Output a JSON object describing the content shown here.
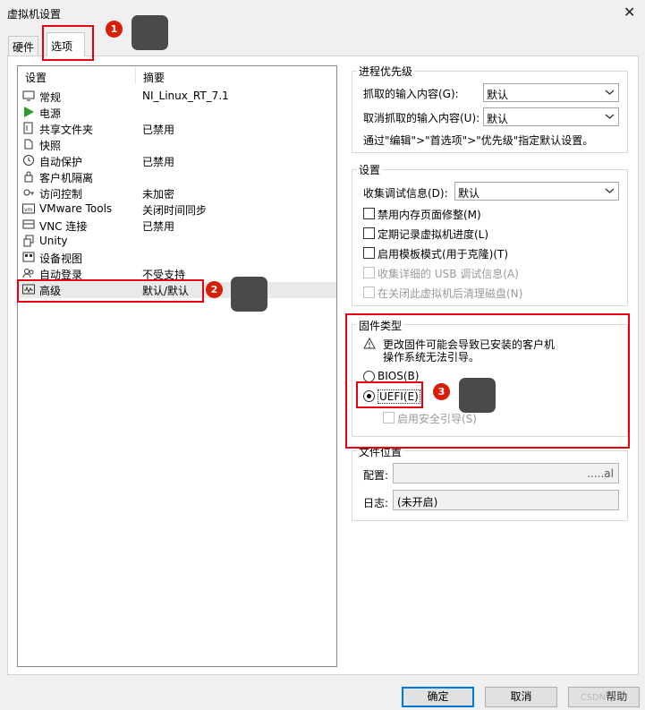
{
  "window": {
    "title": "虚拟机设置",
    "close": "✕"
  },
  "tabs": [
    {
      "label": "硬件"
    },
    {
      "label": "选项"
    }
  ],
  "list": {
    "header": {
      "setting": "设置",
      "summary": "摘要"
    },
    "items": [
      {
        "name": "常规",
        "summary": "NI_Linux_RT_7.1",
        "icon": "monitor-icon"
      },
      {
        "name": "电源",
        "summary": "",
        "icon": "play-icon"
      },
      {
        "name": "共享文件夹",
        "summary": "已禁用",
        "icon": "shared-folder-icon"
      },
      {
        "name": "快照",
        "summary": "",
        "icon": "snapshot-icon"
      },
      {
        "name": "自动保护",
        "summary": "已禁用",
        "icon": "clock-icon"
      },
      {
        "name": "客户机隔离",
        "summary": "",
        "icon": "lock-icon"
      },
      {
        "name": "访问控制",
        "summary": "未加密",
        "icon": "key-icon"
      },
      {
        "name": "VMware Tools",
        "summary": "关闭时间同步",
        "icon": "vm-icon"
      },
      {
        "name": "VNC 连接",
        "summary": "已禁用",
        "icon": "vnc-icon"
      },
      {
        "name": "Unity",
        "summary": "",
        "icon": "unity-icon"
      },
      {
        "name": "设备视图",
        "summary": "",
        "icon": "device-view-icon"
      },
      {
        "name": "自动登录",
        "summary": "不受支持",
        "icon": "users-icon"
      },
      {
        "name": "高级",
        "summary": "默认/默认",
        "icon": "pulse-icon"
      }
    ]
  },
  "priority": {
    "title": "进程优先级",
    "grab_label": "抓取的输入内容(G):",
    "grab_value": "默认",
    "ungrab_label": "取消抓取的输入内容(U):",
    "ungrab_value": "默认",
    "note": "通过\"编辑\">\"首选项\">\"优先级\"指定默认设置。"
  },
  "settings": {
    "title": "设置",
    "debug_label": "收集调试信息(D):",
    "debug_value": "默认",
    "checks": [
      {
        "label": "禁用内存页面修整(M)",
        "enabled": true
      },
      {
        "label": "定期记录虚拟机进度(L)",
        "enabled": true
      },
      {
        "label": "启用模板模式(用于克隆)(T)",
        "enabled": true
      },
      {
        "label": "收集详细的 USB 调试信息(A)",
        "enabled": false
      },
      {
        "label": "在关闭此虚拟机后清理磁盘(N)",
        "enabled": false
      }
    ]
  },
  "firmware": {
    "title": "固件类型",
    "warning_icon": "warning-icon",
    "warning_line1": "更改固件可能会导致已安装的客户机",
    "warning_line2": "操作系统无法引导。",
    "bios_label": "BIOS(B)",
    "uefi_label": "UEFI(E)",
    "selected": "UEFI",
    "secure_boot_label": "启用安全引导(S)"
  },
  "file_location": {
    "title": "文件位置",
    "config_label": "配置:",
    "config_value": ".....al",
    "log_label": "日志:",
    "log_value": "(未开启)"
  },
  "buttons": {
    "ok": "确定",
    "cancel": "取消",
    "help": "帮助"
  },
  "annotations": {
    "badge1": "1",
    "badge2": "2",
    "badge3": "3"
  },
  "colors": {
    "highlight": "#e60012",
    "badge": "#d81e06",
    "focus": "#0078d7"
  },
  "watermark": "CSDN"
}
